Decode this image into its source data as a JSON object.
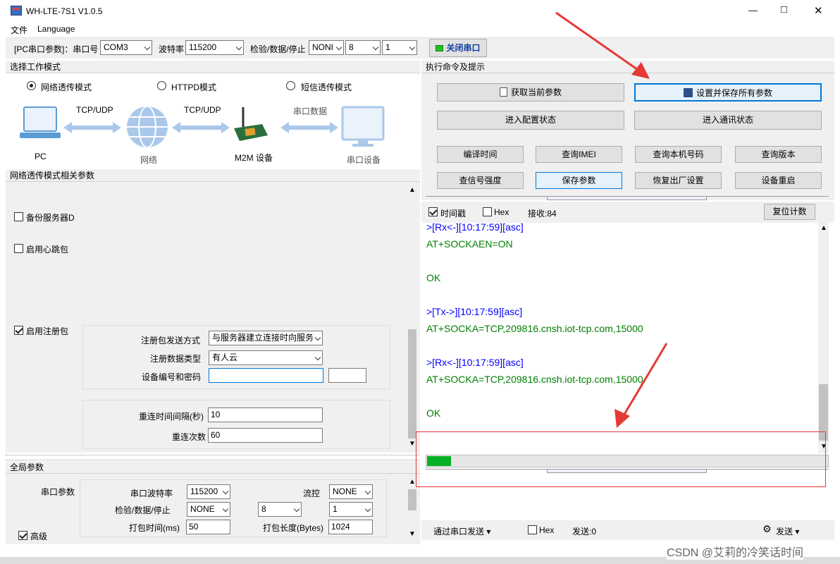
{
  "window": {
    "title": "WH-LTE-7S1 V1.0.5",
    "controls": {
      "minimize": "—",
      "maximize": "□",
      "close": "✕"
    }
  },
  "menu": [
    "文件",
    "Language"
  ],
  "serial_bar": {
    "port_label": "[PC串口参数]：串口号",
    "port_value": "COM3",
    "baud_label": "波特率",
    "baud_value": "115200",
    "parity_label": "检验/数据/停止",
    "parity_value": "NONI",
    "data_value": "8",
    "stop_value": "1",
    "close_port_label": "关闭串口"
  },
  "mode_panel": {
    "header": "选择工作模式",
    "modes": [
      {
        "label": "网络透传模式",
        "selected": true
      },
      {
        "label": "HTTPD模式",
        "selected": false
      },
      {
        "label": "短信透传模式",
        "selected": false
      }
    ],
    "diagram": {
      "pc": "PC",
      "tcp1": "TCP/UDP",
      "net": "网络",
      "tcp2": "TCP/UDP",
      "m2m": "M2M 设备",
      "serial_data": "串口数据",
      "serial_dev": "串口设备"
    }
  },
  "net_params": {
    "header": "网络透传模式相关参数",
    "backup_server": "备份服务器D",
    "heartbeat": "启用心跳包",
    "register": "启用注册包",
    "reg_method_label": "注册包发送方式",
    "reg_method_value": "与服务器建立连接时向服务",
    "reg_type_label": "注册数据类型",
    "reg_type_value": "有人云",
    "dev_id_label": "设备编号和密码",
    "dev_id_value": "",
    "dev_pw_value": "",
    "reconnect_interval_label": "重连时间间隔(秒)",
    "reconnect_interval_value": "10",
    "reconnect_count_label": "重连次数",
    "reconnect_count_value": "60"
  },
  "global_params": {
    "header": "全局参数",
    "serial_params": "串口参数",
    "advanced": "高级",
    "baud_label": "串口波特率",
    "baud_value": "115200",
    "flow_label": "流控",
    "flow_value": "NONE",
    "parity_label": "检验/数据/停止",
    "parity_value": "NONE",
    "data_value": "8",
    "stop_value": "1",
    "pack_time_label": "打包时间(ms)",
    "pack_time_value": "50",
    "pack_len_label": "打包长度(Bytes)",
    "pack_len_value": "1024"
  },
  "cmd_panel": {
    "header": "执行命令及提示",
    "get_params": "获取当前参数",
    "save_all": "设置并保存所有参数",
    "enter_config": "进入配置状态",
    "enter_comm": "进入通讯状态",
    "compile_time": "编译时间",
    "query_imei": "查询IMEI",
    "query_number": "查询本机号码",
    "query_version": "查询版本",
    "signal": "查信号强度",
    "save_params": "保存参数",
    "factory_reset": "恢复出厂设置",
    "reboot": "设备重启"
  },
  "log_bar": {
    "timestamp": "时间戳",
    "hex": "Hex",
    "rx_count": "接收:84",
    "reset_count": "复位计数"
  },
  "log": [
    {
      "text": ">[Rx<-][10:17:59][asc]",
      "color": "blue"
    },
    {
      "text": "AT+SOCKAEN=ON",
      "color": "green"
    },
    {
      "text": "",
      "color": "green"
    },
    {
      "text": "OK",
      "color": "green"
    },
    {
      "text": "",
      "color": "green"
    },
    {
      "text": ">[Tx->][10:17:59][asc]",
      "color": "blue"
    },
    {
      "text": "AT+SOCKA=TCP,209816.cnsh.iot-tcp.com,15000",
      "color": "green"
    },
    {
      "text": "",
      "color": "green"
    },
    {
      "text": ">[Rx<-][10:17:59][asc]",
      "color": "blue"
    },
    {
      "text": "AT+SOCKA=TCP,209816.cnsh.iot-tcp.com,15000",
      "color": "green"
    },
    {
      "text": "",
      "color": "green"
    },
    {
      "text": "OK",
      "color": "green"
    }
  ],
  "send_bar": {
    "send_via": "通过串口发送",
    "hex": "Hex",
    "sent_count": "发送:0",
    "send_button": "发送"
  },
  "progress": 0.06,
  "watermark": "CSDN @艾莉的冷笑话时间",
  "colors": {
    "accent": "#0078d7",
    "annotation": "#e53935",
    "progress": "#06b025",
    "log_blue": "#0000ff",
    "log_green": "#008000"
  }
}
